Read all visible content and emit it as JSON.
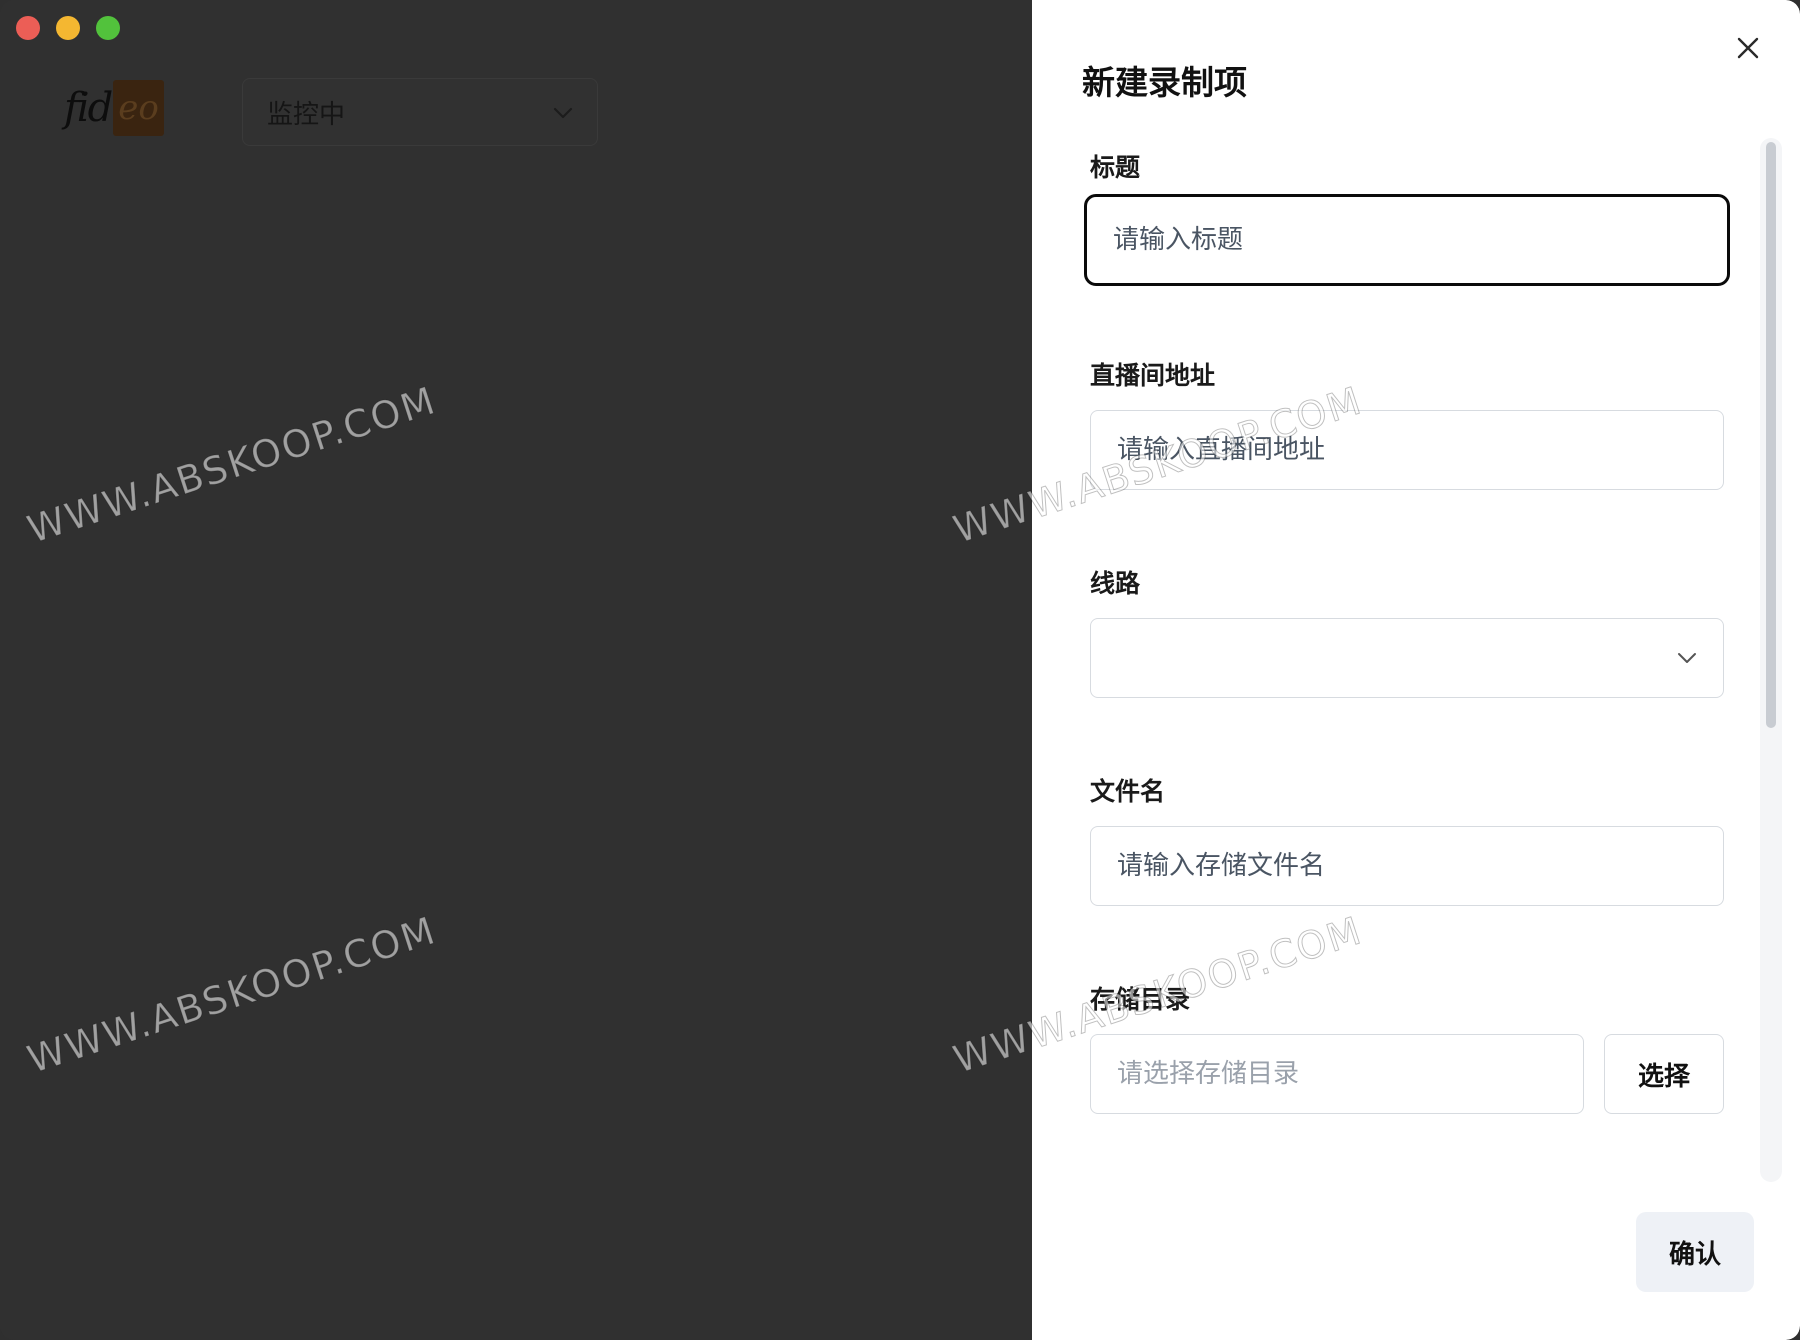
{
  "app": {
    "logo_text_left": "fid",
    "logo_text_right": "eo",
    "status_select": {
      "value": "监控中"
    }
  },
  "drawer": {
    "title": "新建录制项",
    "fields": {
      "title": {
        "label": "标题",
        "placeholder": "请输入标题"
      },
      "room_url": {
        "label": "直播间地址",
        "placeholder": "请输入直播间地址"
      },
      "line": {
        "label": "线路",
        "value": ""
      },
      "filename": {
        "label": "文件名",
        "placeholder": "请输入存储文件名"
      },
      "directory": {
        "label": "存储目录",
        "placeholder": "请选择存储目录",
        "button": "选择"
      }
    },
    "confirm_label": "确认"
  },
  "watermark": {
    "text": "WWW.ABSKOOP.COM"
  },
  "colors": {
    "backdrop": "#303030",
    "drawer": "#ffffff",
    "focus_border": "#0a0a0a",
    "input_border": "#d7dbe0",
    "confirm_bg": "#eef1f6",
    "traffic_close": "#ec5e56",
    "traffic_min": "#f4b731",
    "traffic_max": "#52c23c"
  }
}
